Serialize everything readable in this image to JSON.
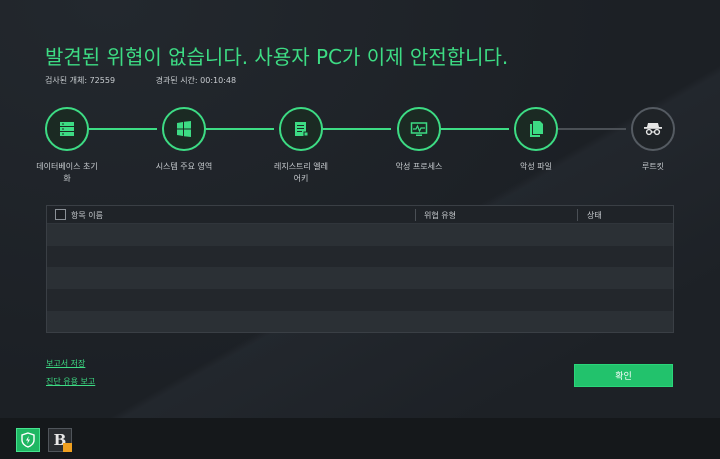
{
  "header": {
    "title": "발견된 위협이 없습니다. 사용자 PC가 이제 안전합니다.",
    "scanned_label": "검사된 개체: 72559",
    "elapsed_label": "경과된 시간: 00:10:48"
  },
  "steps": [
    {
      "label": "데이터베이스 초기화",
      "icon": "database-icon",
      "state": "done"
    },
    {
      "label": "시스템 주요 영역",
      "icon": "windows-icon",
      "state": "done"
    },
    {
      "label": "레지스트리 엘레어키",
      "icon": "registry-icon",
      "state": "done"
    },
    {
      "label": "악성 프로세스",
      "icon": "process-monitor-icon",
      "state": "done"
    },
    {
      "label": "악성 파일",
      "icon": "file-icon",
      "state": "done"
    },
    {
      "label": "루트킷",
      "icon": "spy-icon",
      "state": "pending"
    }
  ],
  "table": {
    "headers": [
      "항목 이름",
      "위협 유형",
      "상태"
    ],
    "row_count": 5
  },
  "links": {
    "save_report": "보고서 저장",
    "diagnose_report": "진단 유용 보고"
  },
  "buttons": {
    "ok": "확인"
  },
  "colors": {
    "accent": "#3ddc84",
    "button": "#22c26c",
    "background": "#1d2126"
  }
}
